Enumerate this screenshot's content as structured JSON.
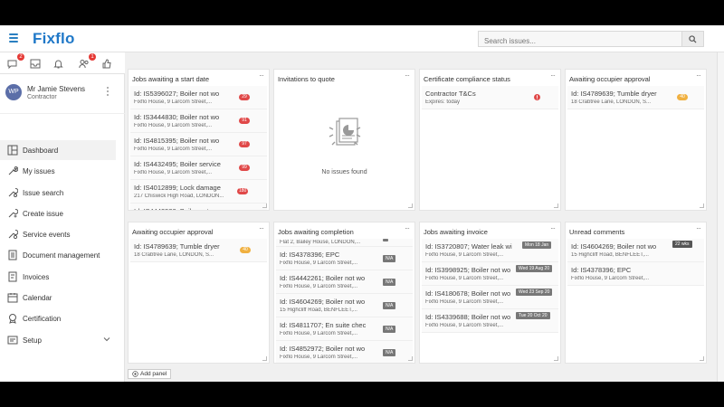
{
  "app": {
    "logo": "Fixflo"
  },
  "search": {
    "placeholder": "Search issues..."
  },
  "header_icons": [
    {
      "name": "messages-icon",
      "badge": "2"
    },
    {
      "name": "inbox-icon",
      "badge": ""
    },
    {
      "name": "bell-icon",
      "badge": ""
    },
    {
      "name": "users-icon",
      "badge": "1"
    },
    {
      "name": "thumbs-up-icon",
      "badge": ""
    }
  ],
  "user": {
    "initials": "WP",
    "name": "Mr Jamie Stevens",
    "role": "Contractor"
  },
  "sidebar": {
    "items": [
      {
        "label": "Dashboard",
        "icon": "dashboard-icon"
      },
      {
        "label": "My issues",
        "icon": "wrench-icon"
      },
      {
        "label": "Issue search",
        "icon": "wrench-search-icon"
      },
      {
        "label": "Create issue",
        "icon": "wrench-plus-icon"
      },
      {
        "label": "Service events",
        "icon": "wrench-cog-icon"
      },
      {
        "label": "Document management",
        "icon": "document-icon"
      },
      {
        "label": "Invoices",
        "icon": "invoice-icon"
      },
      {
        "label": "Calendar",
        "icon": "calendar-icon"
      },
      {
        "label": "Certification",
        "icon": "certificate-icon"
      },
      {
        "label": "Setup",
        "icon": "setup-icon"
      }
    ]
  },
  "panels": {
    "start_date": {
      "title": "Jobs awaiting a start date",
      "rows": [
        {
          "id": "Id: IS5396027; Boiler not wo",
          "addr": "Fixflo House, 9 Larcom Street,...",
          "badge": "29"
        },
        {
          "id": "Id: IS3444830; Boiler not wo",
          "addr": "Fixflo House, 9 Larcom Street,...",
          "badge": "91"
        },
        {
          "id": "Id: IS4815395; Boiler not wo",
          "addr": "Fixflo House, 9 Larcom Street,...",
          "badge": "97"
        },
        {
          "id": "Id: IS4432495; Boiler service",
          "addr": "Fixflo House, 9 Larcom Street,...",
          "badge": "99"
        },
        {
          "id": "Id: IS4012899; Lock damage",
          "addr": "217 Chiswick High Road, LONDON...",
          "badge": "180"
        },
        {
          "id": "Id: IS4442538; Boiler not wo",
          "addr": "",
          "badge": ""
        }
      ]
    },
    "invitations": {
      "title": "Invitations to quote",
      "empty": "No issues found"
    },
    "certificate": {
      "title": "Certificate compliance status",
      "rows": [
        {
          "id": "Contractor T&Cs",
          "addr": "Expires: today"
        }
      ]
    },
    "occupier_top": {
      "title": "Awaiting occupier approval",
      "rows": [
        {
          "id": "Id: IS4789639; Tumble dryer",
          "addr": "18 Crabtree Lane, LONDON, S...",
          "badge": "40"
        }
      ]
    },
    "occupier_bottom": {
      "title": "Awaiting occupier approval",
      "rows": [
        {
          "id": "Id: IS4789639; Tumble dryer",
          "addr": "18 Crabtree Lane, LONDON, S...",
          "badge": "40"
        }
      ]
    },
    "completion": {
      "title": "Jobs awaiting completion",
      "first_addr": "Flat 2, Bailey House, LONDON,...",
      "rows": [
        {
          "id": "Id: IS4378396; EPC",
          "addr": "Fixflo House, 9 Larcom Street,...",
          "tag": "N/A"
        },
        {
          "id": "Id: IS4442261; Boiler not wo",
          "addr": "Fixflo House, 9 Larcom Street,...",
          "tag": "N/A"
        },
        {
          "id": "Id: IS4604269; Boiler not wo",
          "addr": "15 Highcliff Road, BENFLEET,...",
          "tag": "N/A"
        },
        {
          "id": "Id: IS4811707; En suite chec",
          "addr": "Fixflo House, 9 Larcom Street,...",
          "tag": "N/A"
        },
        {
          "id": "Id: IS4852972; Boiler not wo",
          "addr": "Fixflo House, 9 Larcom Street,...",
          "tag": "N/A"
        }
      ]
    },
    "invoice": {
      "title": "Jobs awaiting invoice",
      "rows": [
        {
          "id": "Id: IS3720807; Water leak wi",
          "addr": "Fixflo House, 9 Larcom Street,...",
          "tag": "Mon 18 Jan"
        },
        {
          "id": "Id: IS3998925; Boiler not wo",
          "addr": "Fixflo House, 9 Larcom Street,...",
          "tag": "Wed 19 Aug 20"
        },
        {
          "id": "Id: IS4180678; Boiler not wo",
          "addr": "Fixflo House, 9 Larcom Street,...",
          "tag": "Wed 23 Sep 20"
        },
        {
          "id": "Id: IS4339688; Boiler not wo",
          "addr": "Fixflo House, 9 Larcom Street,...",
          "tag": "Tue 20 Oct 20"
        }
      ]
    },
    "comments": {
      "title": "Unread comments",
      "rows": [
        {
          "id": "Id: IS4604269; Boiler not wo",
          "addr": "15 Highcliff Road, BENFLEET,...",
          "tag": "22 wks"
        },
        {
          "id": "Id: IS4378396; EPC",
          "addr": "Fixflo House, 9 Larcom Street,..."
        }
      ]
    }
  },
  "add_panel": "Add panel",
  "colors": {
    "brand": "#1f78c8",
    "badge_red": "#e04848",
    "badge_orange": "#f0b040"
  }
}
